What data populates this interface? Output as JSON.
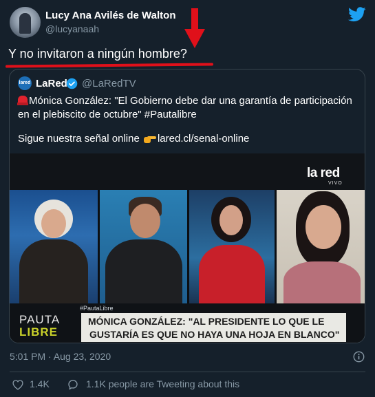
{
  "author": {
    "name": "Lucy Ana Avilés de Walton",
    "handle": "@lucyanaah"
  },
  "tweet_text": "Y no invitaron a ningún hombre?",
  "annotation": {
    "arrow_color": "#e0101a",
    "underline_color": "#e0101a"
  },
  "quoted": {
    "avatar_label": "lared",
    "name": "LaRed",
    "handle": "@LaRedTV",
    "text": "Mónica González: \"El Gobierno debe dar una garantía de participación en el plebiscito de octubre\" #Pautalibre",
    "link_prefix": "Sigue nuestra señal online",
    "link_url": "lared.cl/senal-online",
    "icons": {
      "alert": "siren-icon",
      "pointer": "pointing-hand-icon",
      "verified": "verified-badge-icon"
    },
    "media": {
      "logo": "la red",
      "logo_sub": "VIVO",
      "tag": "#PautaLibre",
      "show_name_top": "PAUTA",
      "show_name_bottom": "LIBRE",
      "headline_line1": "MÓNICA GONZÁLEZ: \"AL PRESIDENTE LO QUE LE",
      "headline_line2": "GUSTARÍA ES QUE NO HAYA UNA HOJA EN BLANCO\""
    }
  },
  "timestamp": "5:01 PM · Aug 23, 2020",
  "likes": "1.4K",
  "people_tweeting": "1.1K people are Tweeting about this",
  "colors": {
    "background": "#15202b",
    "muted": "#8899a6",
    "twitter_blue": "#1da1f2",
    "border": "#38444d"
  }
}
